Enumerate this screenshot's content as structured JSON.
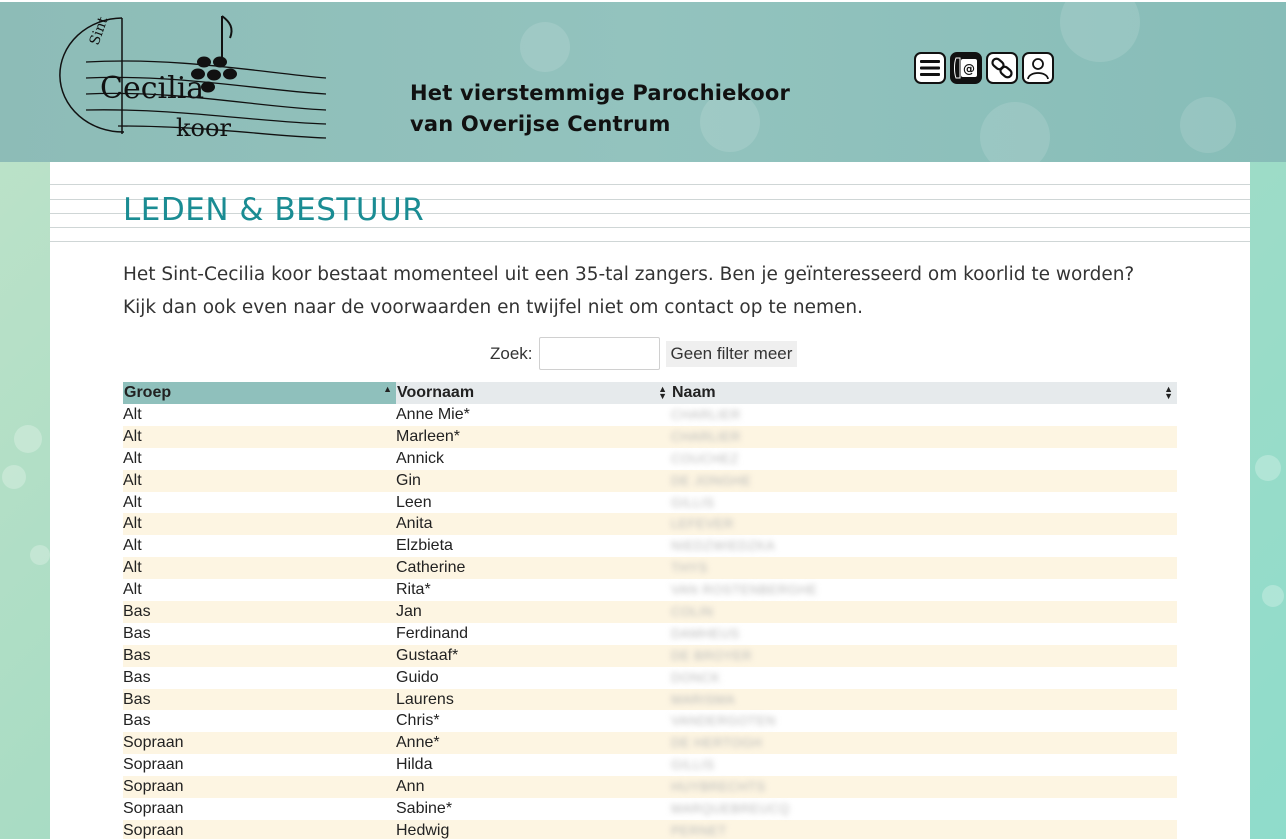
{
  "header": {
    "logo_text": [
      "Sint",
      "Cecilia",
      "koor"
    ],
    "title_line1": "Het vierstemmige Parochiekoor",
    "title_line2": "van Overijse Centrum",
    "icons": [
      "menu-icon",
      "contact-icon",
      "links-icon",
      "user-icon"
    ]
  },
  "main": {
    "heading": "LEDEN & BESTUUR",
    "intro": "Het Sint-Cecilia koor bestaat momenteel uit een 35-tal zangers. Ben je geïnteresseerd om koorlid te worden? Kijk dan ook even naar de voorwaarden en twijfel niet om contact op te nemen.",
    "filter": {
      "label": "Zoek:",
      "input_value": "",
      "reset_label": "Geen filter meer"
    },
    "table": {
      "columns": [
        "Groep",
        "Voornaam",
        "Naam"
      ],
      "rows": [
        {
          "groep": "Alt",
          "voornaam": "Anne Mie*",
          "naam": "CHARLIER"
        },
        {
          "groep": "Alt",
          "voornaam": "Marleen*",
          "naam": "CHARLIER"
        },
        {
          "groep": "Alt",
          "voornaam": "Annick",
          "naam": "COUCHEZ"
        },
        {
          "groep": "Alt",
          "voornaam": "Gin",
          "naam": "DE JONGHE"
        },
        {
          "groep": "Alt",
          "voornaam": "Leen",
          "naam": "GILLIS"
        },
        {
          "groep": "Alt",
          "voornaam": "Anita",
          "naam": "LEFEVER"
        },
        {
          "groep": "Alt",
          "voornaam": "Elzbieta",
          "naam": "NIEDZWIEDZKA"
        },
        {
          "groep": "Alt",
          "voornaam": "Catherine",
          "naam": "THYS"
        },
        {
          "groep": "Alt",
          "voornaam": "Rita*",
          "naam": "VAN ROSTENBERGHE"
        },
        {
          "groep": "Bas",
          "voornaam": "Jan",
          "naam": "COLIN"
        },
        {
          "groep": "Bas",
          "voornaam": "Ferdinand",
          "naam": "DAMHEUS"
        },
        {
          "groep": "Bas",
          "voornaam": "Gustaaf*",
          "naam": "DE BROYER"
        },
        {
          "groep": "Bas",
          "voornaam": "Guido",
          "naam": "DONCK"
        },
        {
          "groep": "Bas",
          "voornaam": "Laurens",
          "naam": "MARISMA"
        },
        {
          "groep": "Bas",
          "voornaam": "Chris*",
          "naam": "VANDERGOTEN"
        },
        {
          "groep": "Sopraan",
          "voornaam": "Anne*",
          "naam": "DE HERTOGH"
        },
        {
          "groep": "Sopraan",
          "voornaam": "Hilda",
          "naam": "GILLIS"
        },
        {
          "groep": "Sopraan",
          "voornaam": "Ann",
          "naam": "HUYBRECHTS"
        },
        {
          "groep": "Sopraan",
          "voornaam": "Sabine*",
          "naam": "MARQUEBREUCQ"
        },
        {
          "groep": "Sopraan",
          "voornaam": "Hedwig",
          "naam": "PERNET"
        }
      ]
    }
  },
  "colors": {
    "header_bg": "#8dbcb7",
    "heading": "#1a8c93",
    "sorted_header": "#8fc0bc",
    "header_cell": "#e6eaec",
    "row_alt": "#fdf5e2"
  }
}
